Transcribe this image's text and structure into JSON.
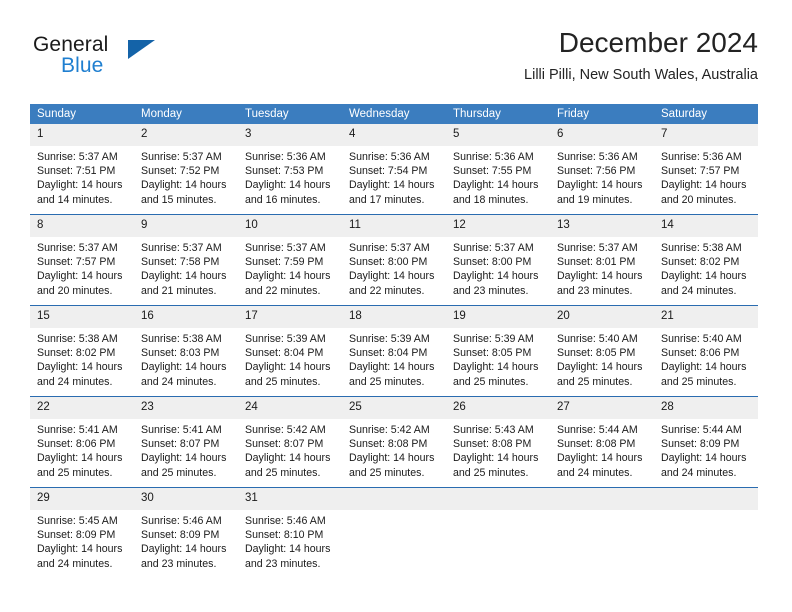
{
  "brand": {
    "name_part1": "General",
    "name_part2": "Blue",
    "triangle_color": "#1463a8",
    "blue_color": "#1f7fd0"
  },
  "header": {
    "title": "December 2024",
    "subtitle": "Lilli Pilli, New South Wales, Australia"
  },
  "theme": {
    "header_row_bg": "#3b7dbf",
    "day_number_bg": "#efefef",
    "week_separator": "#2a6cb0",
    "text": "#1a1a1a"
  },
  "weekdays": [
    "Sunday",
    "Monday",
    "Tuesday",
    "Wednesday",
    "Thursday",
    "Friday",
    "Saturday"
  ],
  "weeks": [
    [
      {
        "day": "1",
        "sunrise": "Sunrise: 5:37 AM",
        "sunset": "Sunset: 7:51 PM",
        "daylight1": "Daylight: 14 hours",
        "daylight2": "and 14 minutes."
      },
      {
        "day": "2",
        "sunrise": "Sunrise: 5:37 AM",
        "sunset": "Sunset: 7:52 PM",
        "daylight1": "Daylight: 14 hours",
        "daylight2": "and 15 minutes."
      },
      {
        "day": "3",
        "sunrise": "Sunrise: 5:36 AM",
        "sunset": "Sunset: 7:53 PM",
        "daylight1": "Daylight: 14 hours",
        "daylight2": "and 16 minutes."
      },
      {
        "day": "4",
        "sunrise": "Sunrise: 5:36 AM",
        "sunset": "Sunset: 7:54 PM",
        "daylight1": "Daylight: 14 hours",
        "daylight2": "and 17 minutes."
      },
      {
        "day": "5",
        "sunrise": "Sunrise: 5:36 AM",
        "sunset": "Sunset: 7:55 PM",
        "daylight1": "Daylight: 14 hours",
        "daylight2": "and 18 minutes."
      },
      {
        "day": "6",
        "sunrise": "Sunrise: 5:36 AM",
        "sunset": "Sunset: 7:56 PM",
        "daylight1": "Daylight: 14 hours",
        "daylight2": "and 19 minutes."
      },
      {
        "day": "7",
        "sunrise": "Sunrise: 5:36 AM",
        "sunset": "Sunset: 7:57 PM",
        "daylight1": "Daylight: 14 hours",
        "daylight2": "and 20 minutes."
      }
    ],
    [
      {
        "day": "8",
        "sunrise": "Sunrise: 5:37 AM",
        "sunset": "Sunset: 7:57 PM",
        "daylight1": "Daylight: 14 hours",
        "daylight2": "and 20 minutes."
      },
      {
        "day": "9",
        "sunrise": "Sunrise: 5:37 AM",
        "sunset": "Sunset: 7:58 PM",
        "daylight1": "Daylight: 14 hours",
        "daylight2": "and 21 minutes."
      },
      {
        "day": "10",
        "sunrise": "Sunrise: 5:37 AM",
        "sunset": "Sunset: 7:59 PM",
        "daylight1": "Daylight: 14 hours",
        "daylight2": "and 22 minutes."
      },
      {
        "day": "11",
        "sunrise": "Sunrise: 5:37 AM",
        "sunset": "Sunset: 8:00 PM",
        "daylight1": "Daylight: 14 hours",
        "daylight2": "and 22 minutes."
      },
      {
        "day": "12",
        "sunrise": "Sunrise: 5:37 AM",
        "sunset": "Sunset: 8:00 PM",
        "daylight1": "Daylight: 14 hours",
        "daylight2": "and 23 minutes."
      },
      {
        "day": "13",
        "sunrise": "Sunrise: 5:37 AM",
        "sunset": "Sunset: 8:01 PM",
        "daylight1": "Daylight: 14 hours",
        "daylight2": "and 23 minutes."
      },
      {
        "day": "14",
        "sunrise": "Sunrise: 5:38 AM",
        "sunset": "Sunset: 8:02 PM",
        "daylight1": "Daylight: 14 hours",
        "daylight2": "and 24 minutes."
      }
    ],
    [
      {
        "day": "15",
        "sunrise": "Sunrise: 5:38 AM",
        "sunset": "Sunset: 8:02 PM",
        "daylight1": "Daylight: 14 hours",
        "daylight2": "and 24 minutes."
      },
      {
        "day": "16",
        "sunrise": "Sunrise: 5:38 AM",
        "sunset": "Sunset: 8:03 PM",
        "daylight1": "Daylight: 14 hours",
        "daylight2": "and 24 minutes."
      },
      {
        "day": "17",
        "sunrise": "Sunrise: 5:39 AM",
        "sunset": "Sunset: 8:04 PM",
        "daylight1": "Daylight: 14 hours",
        "daylight2": "and 25 minutes."
      },
      {
        "day": "18",
        "sunrise": "Sunrise: 5:39 AM",
        "sunset": "Sunset: 8:04 PM",
        "daylight1": "Daylight: 14 hours",
        "daylight2": "and 25 minutes."
      },
      {
        "day": "19",
        "sunrise": "Sunrise: 5:39 AM",
        "sunset": "Sunset: 8:05 PM",
        "daylight1": "Daylight: 14 hours",
        "daylight2": "and 25 minutes."
      },
      {
        "day": "20",
        "sunrise": "Sunrise: 5:40 AM",
        "sunset": "Sunset: 8:05 PM",
        "daylight1": "Daylight: 14 hours",
        "daylight2": "and 25 minutes."
      },
      {
        "day": "21",
        "sunrise": "Sunrise: 5:40 AM",
        "sunset": "Sunset: 8:06 PM",
        "daylight1": "Daylight: 14 hours",
        "daylight2": "and 25 minutes."
      }
    ],
    [
      {
        "day": "22",
        "sunrise": "Sunrise: 5:41 AM",
        "sunset": "Sunset: 8:06 PM",
        "daylight1": "Daylight: 14 hours",
        "daylight2": "and 25 minutes."
      },
      {
        "day": "23",
        "sunrise": "Sunrise: 5:41 AM",
        "sunset": "Sunset: 8:07 PM",
        "daylight1": "Daylight: 14 hours",
        "daylight2": "and 25 minutes."
      },
      {
        "day": "24",
        "sunrise": "Sunrise: 5:42 AM",
        "sunset": "Sunset: 8:07 PM",
        "daylight1": "Daylight: 14 hours",
        "daylight2": "and 25 minutes."
      },
      {
        "day": "25",
        "sunrise": "Sunrise: 5:42 AM",
        "sunset": "Sunset: 8:08 PM",
        "daylight1": "Daylight: 14 hours",
        "daylight2": "and 25 minutes."
      },
      {
        "day": "26",
        "sunrise": "Sunrise: 5:43 AM",
        "sunset": "Sunset: 8:08 PM",
        "daylight1": "Daylight: 14 hours",
        "daylight2": "and 25 minutes."
      },
      {
        "day": "27",
        "sunrise": "Sunrise: 5:44 AM",
        "sunset": "Sunset: 8:08 PM",
        "daylight1": "Daylight: 14 hours",
        "daylight2": "and 24 minutes."
      },
      {
        "day": "28",
        "sunrise": "Sunrise: 5:44 AM",
        "sunset": "Sunset: 8:09 PM",
        "daylight1": "Daylight: 14 hours",
        "daylight2": "and 24 minutes."
      }
    ],
    [
      {
        "day": "29",
        "sunrise": "Sunrise: 5:45 AM",
        "sunset": "Sunset: 8:09 PM",
        "daylight1": "Daylight: 14 hours",
        "daylight2": "and 24 minutes."
      },
      {
        "day": "30",
        "sunrise": "Sunrise: 5:46 AM",
        "sunset": "Sunset: 8:09 PM",
        "daylight1": "Daylight: 14 hours",
        "daylight2": "and 23 minutes."
      },
      {
        "day": "31",
        "sunrise": "Sunrise: 5:46 AM",
        "sunset": "Sunset: 8:10 PM",
        "daylight1": "Daylight: 14 hours",
        "daylight2": "and 23 minutes."
      },
      {
        "day": "",
        "sunrise": "",
        "sunset": "",
        "daylight1": "",
        "daylight2": ""
      },
      {
        "day": "",
        "sunrise": "",
        "sunset": "",
        "daylight1": "",
        "daylight2": ""
      },
      {
        "day": "",
        "sunrise": "",
        "sunset": "",
        "daylight1": "",
        "daylight2": ""
      },
      {
        "day": "",
        "sunrise": "",
        "sunset": "",
        "daylight1": "",
        "daylight2": ""
      }
    ]
  ]
}
